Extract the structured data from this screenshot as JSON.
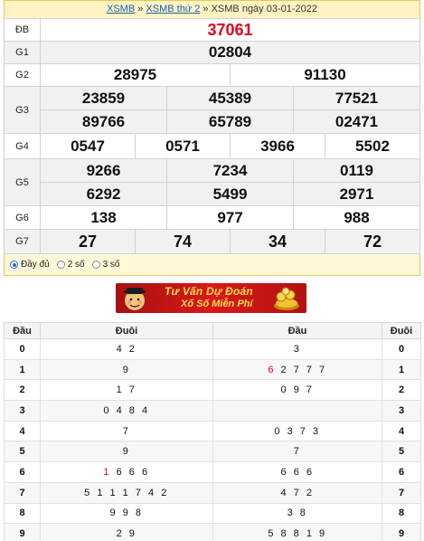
{
  "breadcrumb": {
    "link1": "XSMB",
    "sep1": " » ",
    "link2": "XSMB thứ 2",
    "sep2": " » ",
    "current": "XSMB ngày 03-01-2022"
  },
  "results": {
    "db": {
      "label": "ĐB",
      "values": [
        "37061"
      ]
    },
    "g1": {
      "label": "G1",
      "values": [
        "02804"
      ]
    },
    "g2": {
      "label": "G2",
      "values": [
        "28975",
        "91130"
      ]
    },
    "g3": {
      "label": "G3",
      "values": [
        "23859",
        "45389",
        "77521",
        "89766",
        "65789",
        "02471"
      ]
    },
    "g4": {
      "label": "G4",
      "values": [
        "0547",
        "0571",
        "3966",
        "5502"
      ]
    },
    "g5": {
      "label": "G5",
      "values": [
        "9266",
        "7234",
        "0119",
        "6292",
        "5499",
        "2971"
      ]
    },
    "g6": {
      "label": "G6",
      "values": [
        "138",
        "977",
        "988"
      ]
    },
    "g7": {
      "label": "G7",
      "values": [
        "27",
        "74",
        "34",
        "72"
      ]
    }
  },
  "options": {
    "full": "Đầy đủ",
    "two": "2 số",
    "three": "3 số",
    "selected": "full"
  },
  "banner": {
    "line1": "Tư Vấn Dự Đoán",
    "line2": "Xổ Số Miễn Phí"
  },
  "loto": {
    "headers": [
      "Đầu",
      "Đuôi",
      "Đầu",
      "Đuôi"
    ],
    "rows": [
      {
        "dau": "0",
        "duoi": "4 2",
        "dau2": "3",
        "duoi2": "0"
      },
      {
        "dau": "1",
        "duoi": "9",
        "dau2_red": "6",
        "dau2": " 2 7 7 7",
        "duoi2": "1"
      },
      {
        "dau": "2",
        "duoi": "1 7",
        "dau2": "0 9 7",
        "duoi2": "2"
      },
      {
        "dau": "3",
        "duoi": "0 4 8 4",
        "dau2": "",
        "duoi2": "3"
      },
      {
        "dau": "4",
        "duoi": "7",
        "dau2": "0 3 7 3",
        "duoi2": "4"
      },
      {
        "dau": "5",
        "duoi": "9",
        "dau2": "7",
        "duoi2": "5"
      },
      {
        "dau": "6",
        "duoi_red": "1",
        "duoi": " 6 6 6",
        "dau2": "6 6 6",
        "duoi2": "6"
      },
      {
        "dau": "7",
        "duoi": "5 1 1 1 7 4 2",
        "dau2": "4 7 2",
        "duoi2": "7"
      },
      {
        "dau": "8",
        "duoi": "9 9 8",
        "dau2": "3 8",
        "duoi2": "8"
      },
      {
        "dau": "9",
        "duoi": "2 9",
        "dau2": "5 8 8 1 9",
        "duoi2": "9"
      }
    ]
  }
}
